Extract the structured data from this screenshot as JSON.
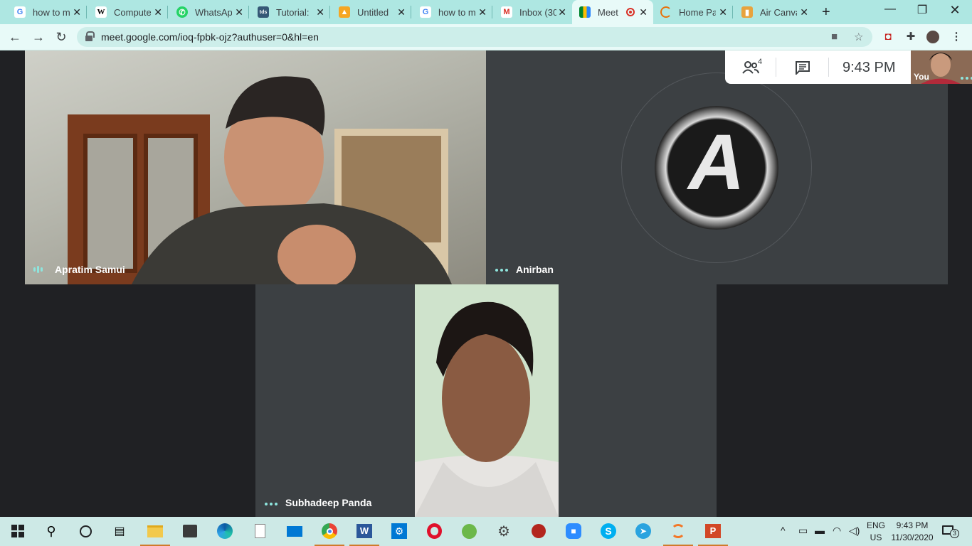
{
  "browser": {
    "tabs": [
      {
        "title": "how to m",
        "icon": "google-icon"
      },
      {
        "title": "Compute",
        "icon": "wikipedia-icon"
      },
      {
        "title": "WhatsAp",
        "icon": "whatsapp-icon"
      },
      {
        "title": "Tutorial:",
        "icon": "tds-icon"
      },
      {
        "title": "Untitled",
        "icon": "document-icon"
      },
      {
        "title": "how to m",
        "icon": "google-icon"
      },
      {
        "title": "Inbox (30",
        "icon": "gmail-icon"
      },
      {
        "title": "Meet",
        "icon": "meet-icon",
        "active": true
      },
      {
        "title": "Home Pa",
        "icon": "loading-icon"
      },
      {
        "title": "Air Canva",
        "icon": "document-icon"
      }
    ],
    "tds_label": "tds",
    "wiki_label": "W",
    "url": "meet.google.com/ioq-fpbk-ojz?authuser=0&hl=en"
  },
  "meet": {
    "participants_count": "4",
    "time": "9:43 PM",
    "self_label": "You",
    "participants": [
      {
        "name": "Apratim Samui"
      },
      {
        "name": "Anirban"
      },
      {
        "name": "Subhadeep Panda"
      }
    ],
    "avatar_letter": "A",
    "colors": {
      "accent": "#8ee5dd",
      "stage": "#202124",
      "tile": "#3c4043"
    }
  },
  "taskbar": {
    "lang_top": "ENG",
    "lang_bottom": "US",
    "clock_time": "9:43 PM",
    "clock_date": "11/30/2020",
    "notifications": "3",
    "word_label": "W",
    "powerpoint_label": "P",
    "skype_label": "S"
  }
}
